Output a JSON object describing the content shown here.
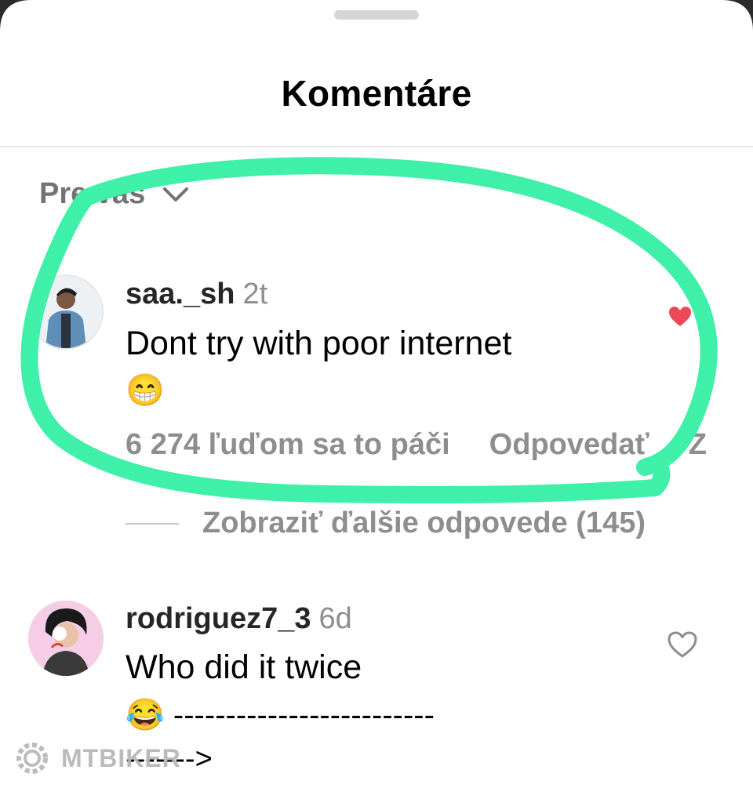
{
  "header": {
    "title": "Komentáre"
  },
  "sort": {
    "label": "Pre vás",
    "icon": "chevron-down-icon"
  },
  "comments": [
    {
      "username": "saa._sh",
      "time": "2t",
      "text": "Dont try with poor internet",
      "emoji": "😁",
      "likes_label": "6 274 ľuďom sa to páči",
      "reply_label": "Odpovedať",
      "extra_label": "Z",
      "view_replies": "Zobraziť ďalšie odpovede (145)",
      "liked": true,
      "like_color": "#ed4956"
    },
    {
      "username": "rodriguez7_3",
      "time": "6d",
      "text": "Who did it twice",
      "emoji_line": "😂 -------------------------",
      "arrow_line": "------->",
      "liked": false
    }
  ],
  "annotation": {
    "color": "#3ef0a8"
  },
  "watermark": {
    "text": "MTBIKER"
  }
}
